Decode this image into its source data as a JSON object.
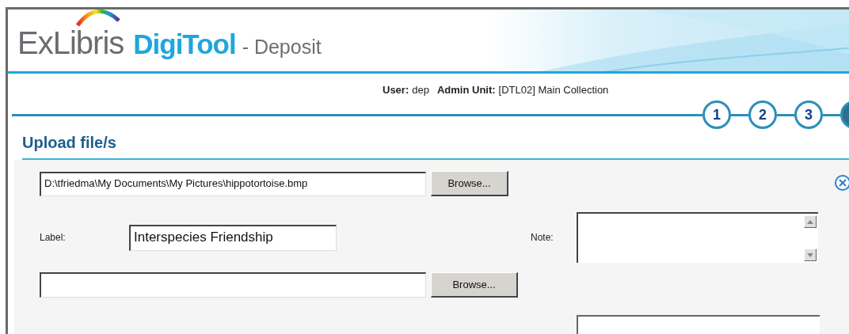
{
  "header": {
    "brand": "ExLibris",
    "product": "DigiTool",
    "section": "- Deposit"
  },
  "user_bar": {
    "user_label": "User:",
    "user": "dep",
    "unit_label": "Admin Unit:",
    "unit": "[DTL02] Main Collection"
  },
  "steps": [
    {
      "label": "1",
      "selected": false
    },
    {
      "label": "2",
      "selected": false
    },
    {
      "label": "3",
      "selected": false
    },
    {
      "selected": true
    }
  ],
  "section_title": "Upload file/s",
  "files": [
    {
      "path": "D:\\tfriedma\\My Documents\\My Pictures\\hippotortoise.bmp",
      "button": "Browse...",
      "label_caption": "Label:",
      "label_value": "Interspecies Friendship",
      "note_caption": "Note:"
    },
    {
      "button": "Browse..."
    }
  ]
}
